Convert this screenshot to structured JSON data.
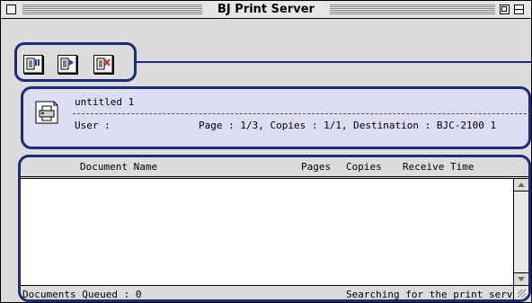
{
  "window": {
    "title": "BJ Print Server"
  },
  "toolbar": {
    "buttons": [
      {
        "icon": "pause-job-icon"
      },
      {
        "icon": "resume-job-icon"
      },
      {
        "icon": "delete-job-icon"
      }
    ]
  },
  "current_job": {
    "name": "untitled 1",
    "user_label": "User :",
    "detail": "Page : 1/3, Copies : 1/1, Destination : BJC-2100 1",
    "icon": "printer-document-icon"
  },
  "queue": {
    "columns": [
      "Document Name",
      "Pages",
      "Copies",
      "Receive Time"
    ],
    "rows": []
  },
  "status": {
    "documents_queued": "Documents Queued :  0",
    "search_status": "Searching for the print server"
  },
  "colors": {
    "annotation_outline": "#1c2a78",
    "job_panel_bg": "#dcdcf2",
    "window_bg": "#dcdcdc"
  }
}
